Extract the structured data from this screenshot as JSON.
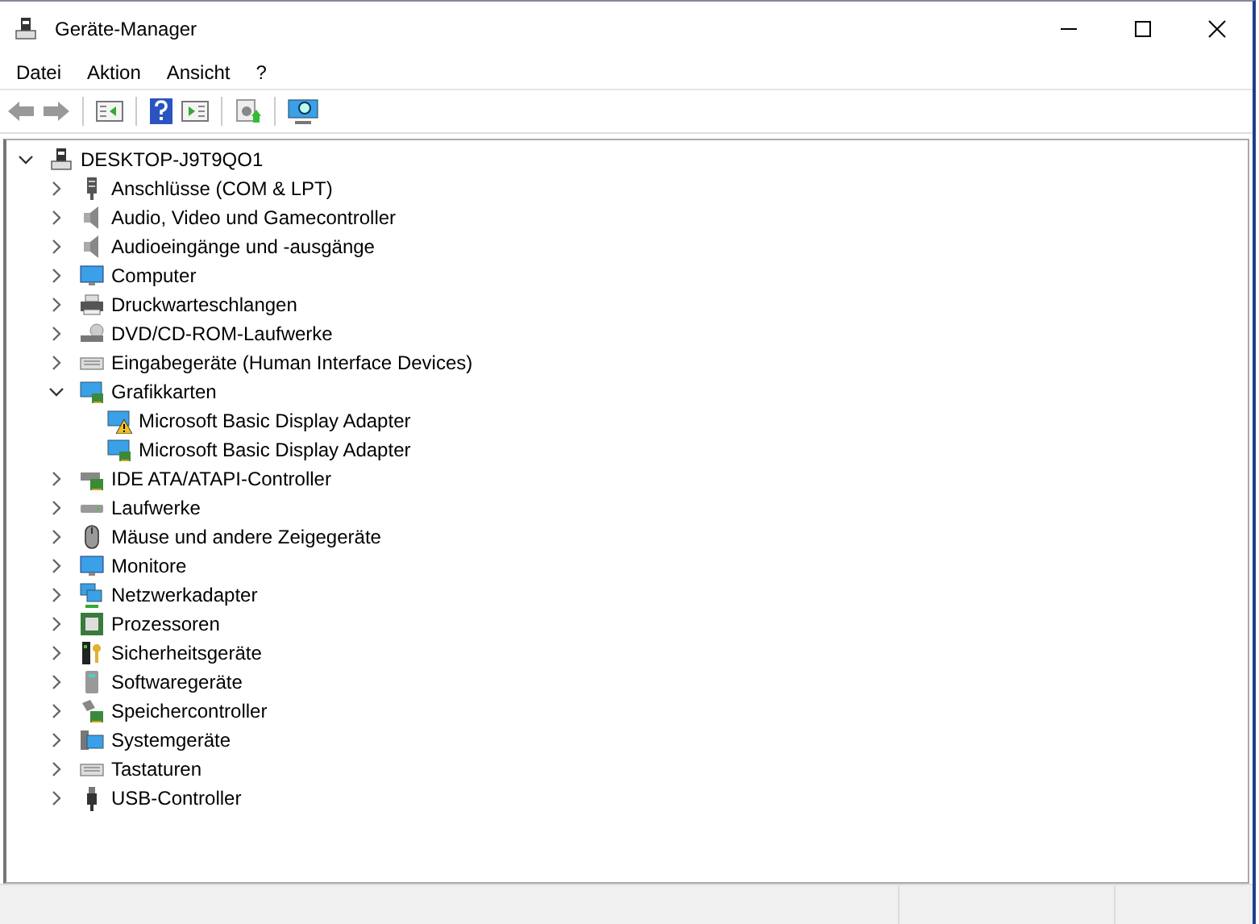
{
  "window": {
    "title": "Geräte-Manager"
  },
  "menu": [
    "Datei",
    "Aktion",
    "Ansicht",
    "?"
  ],
  "tree": {
    "label": "DESKTOP-J9T9QO1",
    "expanded": true,
    "children": [
      {
        "label": "Anschlüsse (COM & LPT)",
        "expanded": false
      },
      {
        "label": "Audio, Video und Gamecontroller",
        "expanded": false
      },
      {
        "label": "Audioeingänge und -ausgänge",
        "expanded": false
      },
      {
        "label": "Computer",
        "expanded": false
      },
      {
        "label": "Druckwarteschlangen",
        "expanded": false
      },
      {
        "label": "DVD/CD-ROM-Laufwerke",
        "expanded": false
      },
      {
        "label": "Eingabegeräte (Human Interface Devices)",
        "expanded": false
      },
      {
        "label": "Grafikkarten",
        "expanded": true,
        "children": [
          {
            "label": "Microsoft Basic Display Adapter",
            "warning": true
          },
          {
            "label": "Microsoft Basic Display Adapter",
            "warning": false
          }
        ]
      },
      {
        "label": "IDE ATA/ATAPI-Controller",
        "expanded": false
      },
      {
        "label": "Laufwerke",
        "expanded": false
      },
      {
        "label": "Mäuse und andere Zeigegeräte",
        "expanded": false
      },
      {
        "label": "Monitore",
        "expanded": false
      },
      {
        "label": "Netzwerkadapter",
        "expanded": false
      },
      {
        "label": "Prozessoren",
        "expanded": false
      },
      {
        "label": "Sicherheitsgeräte",
        "expanded": false
      },
      {
        "label": "Softwaregeräte",
        "expanded": false
      },
      {
        "label": "Speichercontroller",
        "expanded": false
      },
      {
        "label": "Systemgeräte",
        "expanded": false
      },
      {
        "label": "Tastaturen",
        "expanded": false
      },
      {
        "label": "USB-Controller",
        "expanded": false
      }
    ]
  }
}
